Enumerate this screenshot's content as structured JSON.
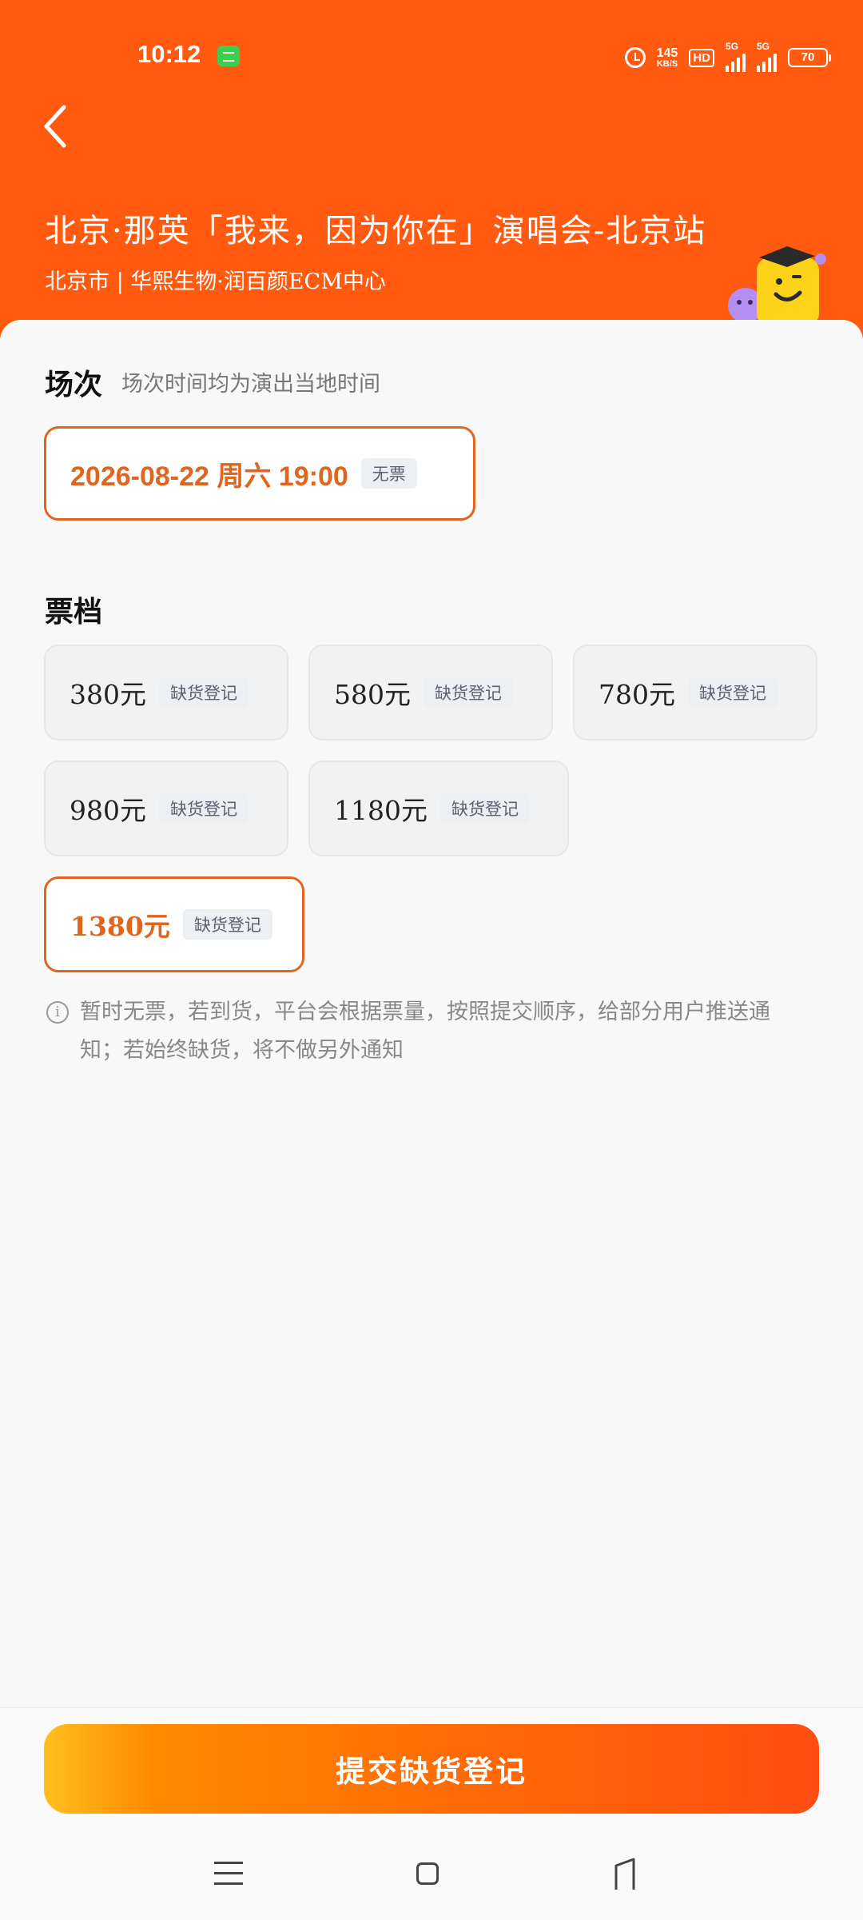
{
  "status_bar": {
    "time": "10:12",
    "net_speed_value": "145",
    "net_speed_unit": "KB/S",
    "hd_label": "HD",
    "signal1_label": "5G",
    "signal2_label": "5G",
    "battery": "70"
  },
  "header": {
    "title": "北京·那英「我来，因为你在」演唱会-北京站",
    "venue": "北京市 | 华熙生物·润百颜ECM中心"
  },
  "session": {
    "title": "场次",
    "note": "场次时间均为演出当地时间",
    "selected": {
      "datetime": "2026-08-22  周六 19:00",
      "badge": "无票"
    }
  },
  "tiers": {
    "title": "票档",
    "items": [
      {
        "price": "380元",
        "badge": "缺货登记"
      },
      {
        "price": "580元",
        "badge": "缺货登记"
      },
      {
        "price": "780元",
        "badge": "缺货登记"
      },
      {
        "price": "980元",
        "badge": "缺货登记"
      },
      {
        "price": "1180元",
        "badge": "缺货登记"
      },
      {
        "price": "1380元",
        "badge": "缺货登记",
        "selected": true
      }
    ]
  },
  "notice": {
    "icon": "info-icon",
    "text": "暂时无票，若到货，平台会根据票量，按照提交顺序，给部分用户推送通知；若始终缺货，将不做另外通知"
  },
  "footer": {
    "submit_label": "提交缺货登记"
  },
  "colors": {
    "brand": "#ff5a0f",
    "accent": "#e0651f",
    "badge_bg": "#edf0f3"
  }
}
